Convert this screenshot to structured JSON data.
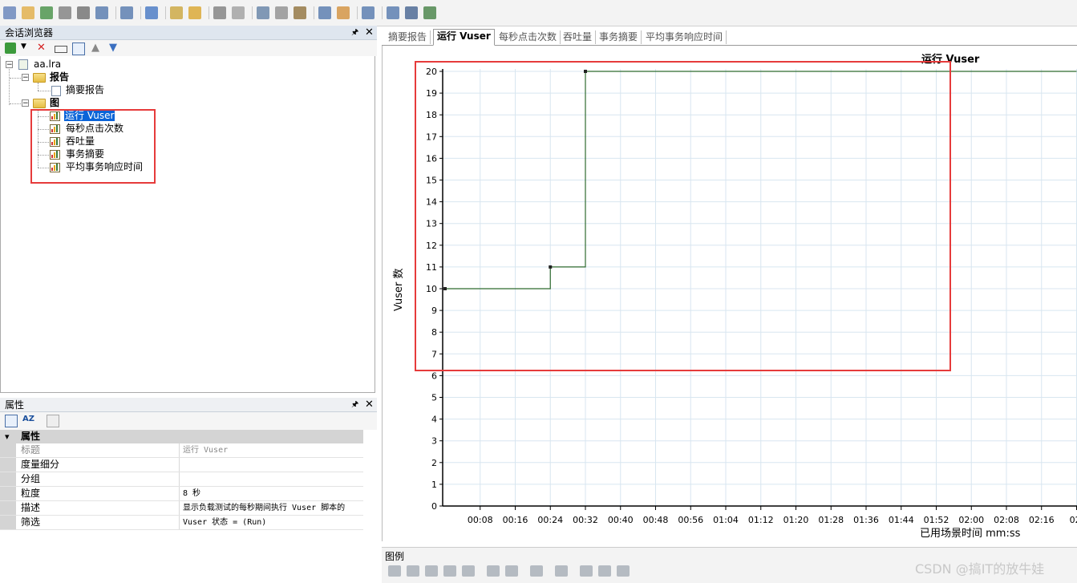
{
  "session_browser": {
    "title": "会话浏览器",
    "pin": "🖈",
    "close": "✕",
    "tree": {
      "root": "aa.lra",
      "reports_folder": "报告",
      "report_items": [
        "摘要报告"
      ],
      "graphs_folder": "图",
      "graph_items": [
        "运行 Vuser",
        "每秒点击次数",
        "吞吐量",
        "事务摘要",
        "平均事务响应时间"
      ],
      "expand_sign": "−"
    }
  },
  "properties": {
    "title": "属性",
    "pin": "🖈",
    "close": "✕",
    "category": "属性",
    "category_toggle": "▾",
    "rows": [
      {
        "key": "标题",
        "value": "运行 Vuser"
      },
      {
        "key": "度量细分",
        "value": ""
      },
      {
        "key": "分组",
        "value": ""
      },
      {
        "key": "粒度",
        "value": "8 秒"
      },
      {
        "key": "描述",
        "value": "显示负载测试的每秒期间执行 Vuser 脚本的"
      },
      {
        "key": "筛选",
        "value": "Vuser 状态 = (Run)"
      }
    ]
  },
  "tabs": [
    "摘要报告",
    "运行 Vuser",
    "每秒点击次数",
    "吞吐量",
    "事务摘要",
    "平均事务响应时间"
  ],
  "active_tab": "运行 Vuser",
  "legend": {
    "title": "图例"
  },
  "watermark": "CSDN @搞IT的放牛娃",
  "colors": {
    "highlight_box": "#e63b3b",
    "series": "#2f6b2f",
    "grid": "#d8e6f0",
    "selection": "#0a64d8"
  },
  "chart_data": {
    "type": "line",
    "title": "运行 Vuser",
    "xlabel": "已用场景时间 mm:ss",
    "ylabel": "Vuser 数",
    "ylim": [
      0,
      20
    ],
    "yticks": [
      "0",
      "1",
      "2",
      "3",
      "4",
      "5",
      "6",
      "7",
      "8",
      "9",
      "10",
      "11",
      "12",
      "13",
      "14",
      "15",
      "16",
      "17",
      "18",
      "19",
      "20"
    ],
    "xtick_labels": [
      "00:08",
      "00:16",
      "00:24",
      "00:32",
      "00:40",
      "00:48",
      "00:56",
      "01:04",
      "01:12",
      "01:20",
      "01:28",
      "01:36",
      "01:44",
      "01:52",
      "02:00",
      "02:08",
      "02:16",
      "02:"
    ],
    "grid": true,
    "line_style": "step",
    "series": [
      {
        "x": [
          "00:00",
          "00:24",
          "00:32",
          "02:24"
        ],
        "values": [
          10,
          11,
          20,
          20
        ]
      }
    ]
  }
}
